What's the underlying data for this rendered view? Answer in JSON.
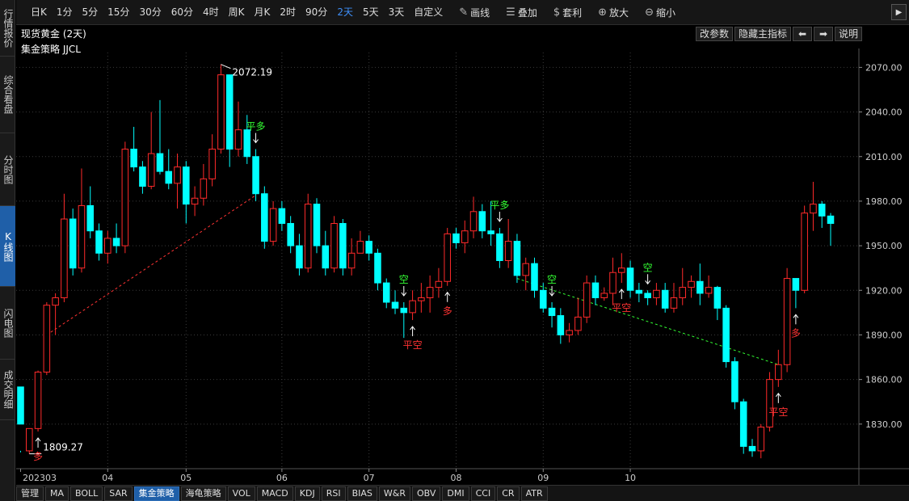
{
  "sidebar": {
    "items": [
      {
        "label": "行情报价",
        "active": false
      },
      {
        "label": "综合看盘",
        "active": false
      },
      {
        "label": "分时图",
        "active": false
      },
      {
        "label": "K线图",
        "active": true
      },
      {
        "label": "闪电图",
        "active": false
      },
      {
        "label": "成交明细",
        "active": false
      }
    ]
  },
  "toolbar": {
    "periods": [
      {
        "label": "日K",
        "active": false
      },
      {
        "label": "1分",
        "active": false
      },
      {
        "label": "5分",
        "active": false
      },
      {
        "label": "15分",
        "active": false
      },
      {
        "label": "30分",
        "active": false
      },
      {
        "label": "60分",
        "active": false
      },
      {
        "label": "4时",
        "active": false
      },
      {
        "label": "周K",
        "active": false
      },
      {
        "label": "月K",
        "active": false
      },
      {
        "label": "2时",
        "active": false
      },
      {
        "label": "90分",
        "active": false
      },
      {
        "label": "2天",
        "active": true
      },
      {
        "label": "5天",
        "active": false
      },
      {
        "label": "3天",
        "active": false
      },
      {
        "label": "自定义",
        "active": false
      }
    ],
    "tools": [
      {
        "label": "画线",
        "icon": "pencil-icon",
        "glyph": "✎"
      },
      {
        "label": "叠加",
        "icon": "layers-icon",
        "glyph": "☰"
      },
      {
        "label": "套利",
        "icon": "money-bag-icon",
        "glyph": "$"
      },
      {
        "label": "放大",
        "icon": "zoom-in-icon",
        "glyph": "⊕"
      },
      {
        "label": "缩小",
        "icon": "zoom-out-icon",
        "glyph": "⊖"
      }
    ],
    "collapse_glyph": "▶"
  },
  "header": {
    "title": "现货黄金 (2天)",
    "strategy": "集金策略 JJCL",
    "buttons": {
      "params": "改参数",
      "hide_main": "隐藏主指标",
      "prev": "⬅",
      "next": "➡",
      "help": "说明"
    }
  },
  "bottom_tabs": [
    {
      "label": "管理",
      "active": false
    },
    {
      "label": "MA",
      "active": false
    },
    {
      "label": "BOLL",
      "active": false
    },
    {
      "label": "SAR",
      "active": false
    },
    {
      "label": "集金策略",
      "active": true
    },
    {
      "label": "海龟策略",
      "active": false
    },
    {
      "label": "VOL",
      "active": false
    },
    {
      "label": "MACD",
      "active": false
    },
    {
      "label": "KDJ",
      "active": false
    },
    {
      "label": "RSI",
      "active": false
    },
    {
      "label": "BIAS",
      "active": false
    },
    {
      "label": "W&R",
      "active": false
    },
    {
      "label": "OBV",
      "active": false
    },
    {
      "label": "DMI",
      "active": false
    },
    {
      "label": "CCI",
      "active": false
    },
    {
      "label": "CR",
      "active": false
    },
    {
      "label": "ATR",
      "active": false
    }
  ],
  "chart_data": {
    "type": "candlestick",
    "y_ticks": [
      "2070.00",
      "2040.00",
      "2010.00",
      "1980.00",
      "1950.00",
      "1920.00",
      "1890.00",
      "1860.00",
      "1830.00"
    ],
    "ylim": [
      1800,
      2080
    ],
    "x_labels": [
      "202303",
      "04",
      "05",
      "06",
      "07",
      "08",
      "09",
      "10"
    ],
    "x_label_index": [
      0,
      10,
      19,
      30,
      40,
      50,
      60,
      70
    ],
    "colors": {
      "up": "#ff2a2a",
      "down": "#00ffff",
      "grid": "#3a3a3a",
      "buy": "#ff3333",
      "sell": "#33ff33",
      "axis_text": "#cccccc"
    },
    "candles": [
      [
        1855,
        1830,
        1812,
        1811
      ],
      [
        1812,
        1827,
        1826,
        1810
      ],
      [
        1827,
        1865,
        1866,
        1825
      ],
      [
        1865,
        1910,
        1912,
        1863
      ],
      [
        1910,
        1915,
        1918,
        1890
      ],
      [
        1915,
        1968,
        1985,
        1912
      ],
      [
        1968,
        1935,
        1975,
        1930
      ],
      [
        1935,
        1977,
        2002,
        1932
      ],
      [
        1977,
        1960,
        1990,
        1955
      ],
      [
        1960,
        1945,
        1965,
        1940
      ],
      [
        1945,
        1955,
        1960,
        1938
      ],
      [
        1955,
        1950,
        1965,
        1945
      ],
      [
        1950,
        2015,
        2020,
        1945
      ],
      [
        2015,
        2003,
        2030,
        2000
      ],
      [
        2003,
        1990,
        2007,
        1985
      ],
      [
        1990,
        2012,
        2040,
        1988
      ],
      [
        2012,
        2000,
        2048,
        1998
      ],
      [
        2000,
        1992,
        2015,
        1988
      ],
      [
        1992,
        2003,
        2012,
        1975
      ],
      [
        2003,
        1978,
        2007,
        1965
      ],
      [
        1978,
        1982,
        1990,
        1970
      ],
      [
        1982,
        1995,
        2005,
        1977
      ],
      [
        1995,
        2015,
        2025,
        1990
      ],
      [
        2015,
        2065,
        2072,
        2012
      ],
      [
        2065,
        2015,
        2063,
        2003
      ],
      [
        2015,
        2028,
        2047,
        2010
      ],
      [
        2028,
        2010,
        2038,
        2005
      ],
      [
        2010,
        1985,
        2015,
        1980
      ],
      [
        1985,
        1953,
        1990,
        1948
      ],
      [
        1953,
        1975,
        1980,
        1950
      ],
      [
        1975,
        1965,
        1980,
        1960
      ],
      [
        1965,
        1950,
        1970,
        1945
      ],
      [
        1950,
        1935,
        1958,
        1930
      ],
      [
        1935,
        1978,
        1985,
        1932
      ],
      [
        1978,
        1950,
        1982,
        1945
      ],
      [
        1950,
        1935,
        1960,
        1930
      ],
      [
        1935,
        1965,
        1970,
        1932
      ],
      [
        1965,
        1935,
        1968,
        1930
      ],
      [
        1935,
        1945,
        1955,
        1930
      ],
      [
        1945,
        1953,
        1960,
        1945
      ],
      [
        1953,
        1945,
        1957,
        1940
      ],
      [
        1945,
        1925,
        1948,
        1920
      ],
      [
        1925,
        1912,
        1928,
        1908
      ],
      [
        1912,
        1908,
        1920,
        1904
      ],
      [
        1908,
        1905,
        1912,
        1888
      ],
      [
        1905,
        1913,
        1920,
        1900
      ],
      [
        1913,
        1915,
        1925,
        1905
      ],
      [
        1915,
        1922,
        1930,
        1905
      ],
      [
        1922,
        1926,
        1935,
        1915
      ],
      [
        1926,
        1958,
        1962,
        1923
      ],
      [
        1958,
        1952,
        1962,
        1948
      ],
      [
        1952,
        1960,
        1967,
        1945
      ],
      [
        1960,
        1973,
        1983,
        1955
      ],
      [
        1973,
        1960,
        1978,
        1955
      ],
      [
        1960,
        1958,
        1980,
        1950
      ],
      [
        1958,
        1940,
        1962,
        1935
      ],
      [
        1940,
        1953,
        1968,
        1935
      ],
      [
        1953,
        1930,
        1958,
        1925
      ],
      [
        1930,
        1938,
        1942,
        1920
      ],
      [
        1938,
        1920,
        1942,
        1915
      ],
      [
        1920,
        1908,
        1925,
        1905
      ],
      [
        1908,
        1903,
        1912,
        1895
      ],
      [
        1903,
        1890,
        1908,
        1884
      ],
      [
        1890,
        1893,
        1898,
        1885
      ],
      [
        1893,
        1902,
        1915,
        1890
      ],
      [
        1902,
        1925,
        1930,
        1898
      ],
      [
        1925,
        1915,
        1930,
        1910
      ],
      [
        1915,
        1918,
        1922,
        1913
      ],
      [
        1918,
        1932,
        1942,
        1910
      ],
      [
        1932,
        1935,
        1945,
        1925
      ],
      [
        1935,
        1920,
        1940,
        1915
      ],
      [
        1920,
        1918,
        1925,
        1912
      ],
      [
        1918,
        1915,
        1920,
        1910
      ],
      [
        1915,
        1920,
        1925,
        1910
      ],
      [
        1920,
        1908,
        1925,
        1905
      ],
      [
        1908,
        1915,
        1925,
        1905
      ],
      [
        1915,
        1922,
        1935,
        1910
      ],
      [
        1922,
        1926,
        1930,
        1915
      ],
      [
        1926,
        1918,
        1938,
        1910
      ],
      [
        1918,
        1922,
        1930,
        1915
      ],
      [
        1922,
        1908,
        1923,
        1900
      ],
      [
        1908,
        1872,
        1910,
        1868
      ],
      [
        1872,
        1845,
        1875,
        1840
      ],
      [
        1845,
        1815,
        1847,
        1810
      ],
      [
        1815,
        1812,
        1820,
        1808
      ],
      [
        1812,
        1828,
        1830,
        1807
      ],
      [
        1828,
        1860,
        1865,
        1825
      ],
      [
        1860,
        1870,
        1880,
        1855
      ],
      [
        1870,
        1928,
        1935,
        1865
      ],
      [
        1928,
        1920,
        1928,
        1908
      ],
      [
        1920,
        1972,
        1977,
        1918
      ],
      [
        1972,
        1978,
        1993,
        1960
      ],
      [
        1978,
        1970,
        1980,
        1962
      ],
      [
        1970,
        1965,
        1972,
        1950
      ]
    ],
    "signals": [
      {
        "index": 2,
        "label": "多",
        "side": "below",
        "color": "buy"
      },
      {
        "index": 27,
        "label": "平多",
        "side": "above",
        "color": "sell"
      },
      {
        "index": 44,
        "label": "空",
        "side": "above",
        "color": "sell"
      },
      {
        "index": 45,
        "label": "平空",
        "side": "below",
        "color": "buy"
      },
      {
        "index": 49,
        "label": "多",
        "side": "below",
        "color": "buy"
      },
      {
        "index": 55,
        "label": "平多",
        "side": "above",
        "color": "sell"
      },
      {
        "index": 61,
        "label": "空",
        "side": "above",
        "color": "sell"
      },
      {
        "index": 69,
        "label": "平空",
        "side": "below",
        "color": "buy"
      },
      {
        "index": 72,
        "label": "空",
        "side": "above",
        "color": "sell"
      },
      {
        "index": 87,
        "label": "平空",
        "side": "below",
        "color": "buy"
      },
      {
        "index": 89,
        "label": "多",
        "side": "below",
        "color": "buy"
      }
    ],
    "trend_lines": [
      {
        "from": 3,
        "to": 27,
        "from_value": 1890,
        "to_value": 1984,
        "color": "buy"
      },
      {
        "from": 57,
        "to": 87,
        "from_value": 1928,
        "to_value": 1870,
        "color": "sell"
      }
    ],
    "extremes": [
      {
        "index": 23,
        "value": "2072.19",
        "side": "high"
      },
      {
        "index": 1,
        "value": "1809.27",
        "side": "low"
      }
    ]
  }
}
